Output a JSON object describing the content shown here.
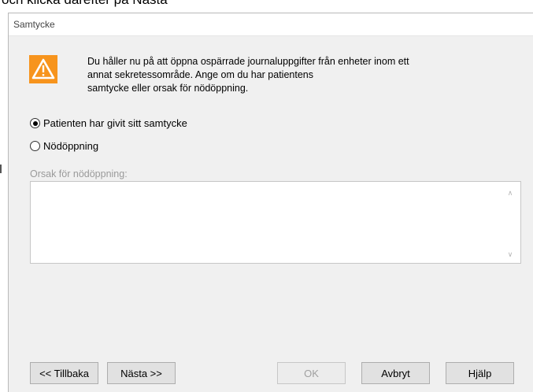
{
  "background_text": "och klicka därefter på Nästa",
  "dialog": {
    "title": "Samtycke",
    "icon": "warning-icon",
    "message_lines": [
      "Du håller nu på att öppna ospärrade journaluppgifter från enheter inom ett",
      "annat sekretessområde. Ange om du har patientens",
      "samtycke eller orsak för nödöppning."
    ],
    "options": [
      {
        "label": "Patienten har givit sitt samtycke",
        "selected": true
      },
      {
        "label": "Nödöppning",
        "selected": false
      }
    ],
    "reason_label": "Orsak för nödöppning:",
    "reason_value": "",
    "buttons": {
      "back": "<< Tillbaka",
      "next": "Nästa >>",
      "ok": "OK",
      "cancel": "Avbryt",
      "help": "Hjälp"
    }
  },
  "colors": {
    "warning_orange": "#f7941d",
    "dialog_bg": "#f0f0f0"
  }
}
